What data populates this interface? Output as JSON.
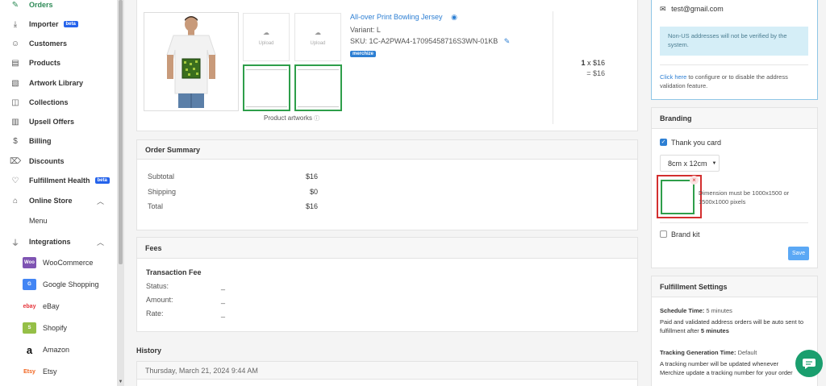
{
  "sidebar": {
    "items": [
      {
        "label": "Orders",
        "icon": "edit-icon"
      },
      {
        "label": "Importer",
        "icon": "download-icon",
        "badge": "beta"
      },
      {
        "label": "Customers",
        "icon": "users-icon"
      },
      {
        "label": "Products",
        "icon": "box-icon"
      },
      {
        "label": "Artwork Library",
        "icon": "image-icon"
      },
      {
        "label": "Collections",
        "icon": "cube-icon"
      },
      {
        "label": "Upsell Offers",
        "icon": "book-icon"
      },
      {
        "label": "Billing",
        "icon": "dollar-icon"
      },
      {
        "label": "Discounts",
        "icon": "tag-icon"
      },
      {
        "label": "Fulfillment Health",
        "icon": "heart-icon",
        "badge": "beta"
      },
      {
        "label": "Online Store",
        "icon": "store-icon"
      },
      {
        "label": "Integrations",
        "icon": "plug-icon"
      }
    ],
    "online_store_sub": "Menu",
    "integrations": [
      {
        "label": "WooCommerce",
        "logo": "Woo"
      },
      {
        "label": "Google Shopping",
        "logo": "G"
      },
      {
        "label": "eBay",
        "logo": "ebay"
      },
      {
        "label": "Shopify",
        "logo": "S"
      },
      {
        "label": "Amazon",
        "logo": "a"
      },
      {
        "label": "Etsy",
        "logo": "Etsy"
      }
    ]
  },
  "product": {
    "name": "All-over Print Bowling Jersey",
    "variant": "Variant: L",
    "sku": "SKU:  1C-A2PWA4-17095458716S3WN-01KB",
    "tag": "merchize",
    "upload_label": "Upload",
    "artworks_label": "Product artworks",
    "qty": "1",
    "price_line": "x $16",
    "total_line": "= $16"
  },
  "order_summary": {
    "title": "Order Summary",
    "rows": [
      {
        "label": "Subtotal",
        "value": "$16"
      },
      {
        "label": "Shipping",
        "value": "$0"
      },
      {
        "label": "Total",
        "value": "$16"
      }
    ]
  },
  "fees": {
    "title": "Fees",
    "subtitle": "Transaction Fee",
    "rows": [
      {
        "label": "Status:",
        "value": "_"
      },
      {
        "label": "Amount:",
        "value": "_"
      },
      {
        "label": "Rate:",
        "value": "_"
      }
    ]
  },
  "history": {
    "title": "History",
    "date": "Thursday, March 21, 2024 9:44 AM"
  },
  "address_panel": {
    "email": "test@gmail.com",
    "notice": "Non-US addresses will not be verified by the system.",
    "link": "Click here",
    "link_rest": " to configure or to disable the address validation feature."
  },
  "branding": {
    "title": "Branding",
    "thank_you_label": "Thank you card",
    "size_option": "8cm x 12cm",
    "dimension_note": "Dimension must be 1000x1500 or 1500x1000 pixels",
    "brand_kit_label": "Brand kit",
    "save_label": "Save"
  },
  "fulfillment": {
    "title": "Fulfillment Settings",
    "schedule_label": "Schedule Time:",
    "schedule_value": "5 minutes",
    "schedule_desc": "Paid and validated address orders will be auto sent to fulfillment after ",
    "schedule_desc_bold": "5 minutes",
    "tracking_label": "Tracking Generation Time:",
    "tracking_value": "Default",
    "tracking_desc": "A tracking number will be updated whenever Merchize update a tracking number for your order"
  },
  "colors": {
    "accent_green": "#2e8b57",
    "link_blue": "#2d7fd3",
    "badge_blue": "#2563eb",
    "artwork_green": "#2e9e4a",
    "highlight_red": "#d32f2f",
    "chat_green": "#1a9e6e"
  }
}
